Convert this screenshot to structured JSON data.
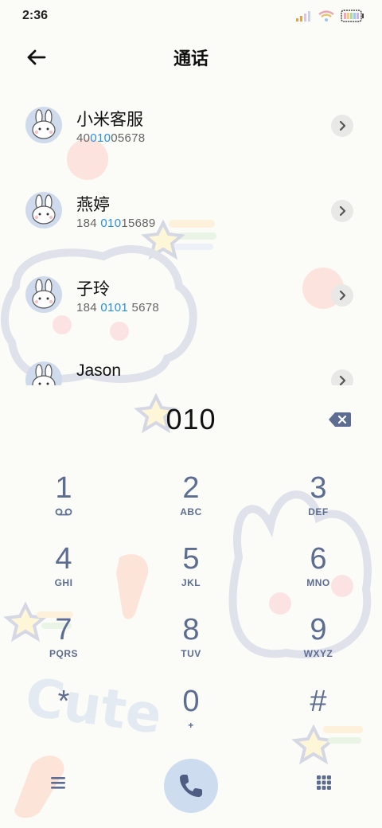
{
  "status_bar": {
    "time": "2:36"
  },
  "header": {
    "title": "通话"
  },
  "contacts": [
    {
      "name": "小米客服",
      "number_parts": [
        "40",
        "010",
        "05678"
      ]
    },
    {
      "name": "燕婷",
      "number_parts": [
        "184 ",
        "010",
        "15689"
      ]
    },
    {
      "name": "子玲",
      "number_parts": [
        "184 ",
        "0101",
        " 5678"
      ]
    },
    {
      "name": "Jason",
      "number_parts": [
        "",
        "",
        ""
      ]
    }
  ],
  "dialer": {
    "number": "010"
  },
  "keypad": [
    {
      "digit": "1",
      "letters": ""
    },
    {
      "digit": "2",
      "letters": "ABC"
    },
    {
      "digit": "3",
      "letters": "DEF"
    },
    {
      "digit": "4",
      "letters": "GHI"
    },
    {
      "digit": "5",
      "letters": "JKL"
    },
    {
      "digit": "6",
      "letters": "MNO"
    },
    {
      "digit": "7",
      "letters": "PQRS"
    },
    {
      "digit": "8",
      "letters": "TUV"
    },
    {
      "digit": "9",
      "letters": "WXYZ"
    },
    {
      "digit": "*",
      "letters": ""
    },
    {
      "digit": "0",
      "letters": "+"
    },
    {
      "digit": "#",
      "letters": ""
    }
  ],
  "colors": {
    "accent": "#2a8fe0",
    "key": "#5d6c91",
    "call_bg": "#cddcef"
  },
  "icons": {
    "back": "arrow-left-icon",
    "backspace": "backspace-icon",
    "menu": "hamburger-menu-icon",
    "call": "phone-icon",
    "dialpad": "dialpad-icon",
    "voicemail": "voicemail-icon"
  }
}
